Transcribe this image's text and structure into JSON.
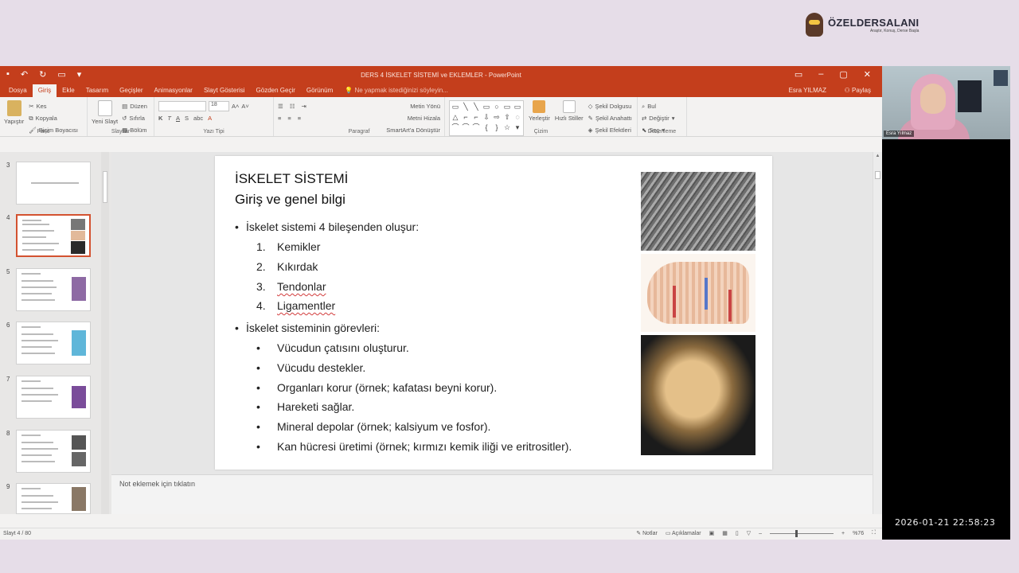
{
  "brand": {
    "name": "ÖZELDERSALANI",
    "tagline": "Araştır, Konuş, Derse Başla"
  },
  "window": {
    "title": "DERS 4 İSKELET SİSTEMİ ve EKLEMLER - PowerPoint",
    "tabs": [
      "Dosya",
      "Giriş",
      "Ekle",
      "Tasarım",
      "Geçişler",
      "Animasyonlar",
      "Slayt Gösterisi",
      "Gözden Geçir",
      "Görünüm"
    ],
    "active_tab": "Giriş",
    "tell_me": "Ne yapmak istediğinizi söyleyin...",
    "user": "Esra YILMAZ",
    "share": "Paylaş"
  },
  "ribbon": {
    "pano": {
      "label": "Pano",
      "paste": "Yapıştır",
      "cut": "Kes",
      "copy": "Kopyala",
      "format_painter": "Biçim Boyacısı"
    },
    "slaytlar": {
      "label": "Slaytlar",
      "new_slide": "Yeni Slayt",
      "layout": "Düzen",
      "reset": "Sıfırla",
      "section": "Bölüm"
    },
    "yazi_tipi": {
      "label": "Yazı Tipi",
      "size": "18"
    },
    "paragraf": {
      "label": "Paragraf",
      "text_direction": "Metin Yönü",
      "align_text": "Metni Hizala",
      "smartart": "SmartArt'a Dönüştür"
    },
    "cizim": {
      "label": "Çizim",
      "arrange": "Yerleştir",
      "quick_styles": "Hızlı Stiller",
      "fill": "Şekil Dolgusu",
      "outline": "Şekil Anahattı",
      "effects": "Şekil Efektleri"
    },
    "duzenleme": {
      "label": "Düzenleme",
      "find": "Bul",
      "replace": "Değiştir",
      "select": "Seç"
    }
  },
  "thumbnails": [
    {
      "num": "3",
      "selected": false
    },
    {
      "num": "4",
      "selected": true
    },
    {
      "num": "5",
      "selected": false
    },
    {
      "num": "6",
      "selected": false
    },
    {
      "num": "7",
      "selected": false
    },
    {
      "num": "8",
      "selected": false
    },
    {
      "num": "9",
      "selected": false
    }
  ],
  "slide": {
    "title_line1": "İSKELET SİSTEMİ",
    "title_line2": "Giriş ve genel bilgi",
    "bullet1": "İskelet sistemi 4 bileşenden oluşur:",
    "components": [
      {
        "n": "1.",
        "text": "Kemikler"
      },
      {
        "n": "2.",
        "text": "Kıkırdak"
      },
      {
        "n": "3.",
        "text": "Tendonlar"
      },
      {
        "n": "4.",
        "text": "Ligamentler"
      }
    ],
    "bullet2": "İskelet sisteminin görevleri:",
    "functions": [
      "Vücudun çatısını oluşturur.",
      "Vücudu destekler.",
      "Organları korur (örnek; kafatası beyni korur).",
      "Hareketi sağlar.",
      "Mineral depolar (örnek; kalsiyum ve fosfor).",
      "Kan hücresi üretimi (örnek; kırmızı kemik iliği ve eritrositler)."
    ]
  },
  "notes_placeholder": "Not eklemek için tıklatın",
  "status": {
    "slide_of": "Slayt 4 / 80",
    "notes": "Notlar",
    "comments": "Açıklamalar",
    "zoom": "%76"
  },
  "webcam": {
    "name": "Esra Yılmaz",
    "timestamp": "2026-01-21  22:58:23"
  },
  "colors": {
    "accent": "#c43e1c",
    "selection": "#d35230"
  }
}
